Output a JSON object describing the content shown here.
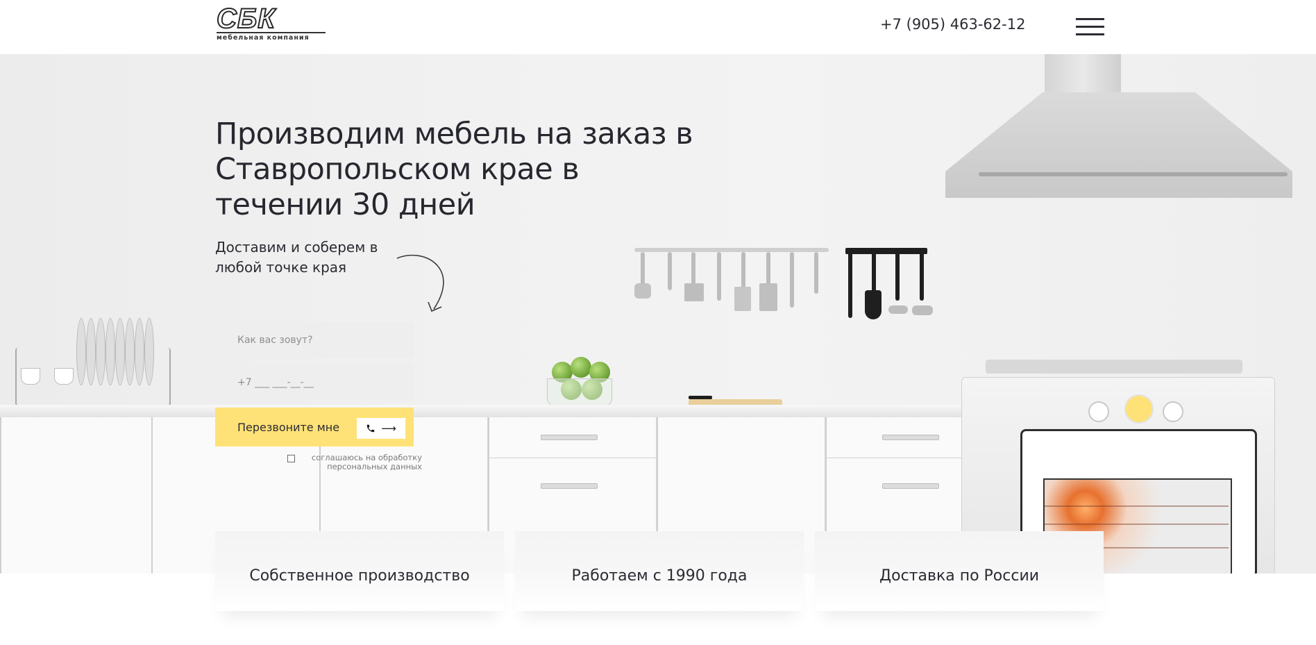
{
  "header": {
    "logo_text": "СБК",
    "logo_subtitle": "мебельная компания",
    "phone": "+7 (905) 463-62-12",
    "menu_icon": "hamburger-menu-icon"
  },
  "hero": {
    "title": "Производим мебель на заказ в Ставропольском крае в течении 30 дней",
    "subtitle": "Доставим и соберем в любой точке края",
    "arrow_icon": "curved-arrow-icon"
  },
  "form": {
    "name_placeholder": "Как вас зовут?",
    "phone_placeholder": "+7 ___ ___-__-__",
    "submit_label": "Перезвоните мне",
    "submit_icons": "phone-icon, arrow-right-icon",
    "consent_text": "соглашаюсь на обработку персональных данных"
  },
  "features": [
    {
      "label": "Собственное производство"
    },
    {
      "label": "Работаем с 1990 года"
    },
    {
      "label": "Доставка по России"
    }
  ],
  "colors": {
    "accent": "#ffe277",
    "text": "#2b2b33",
    "background": "#ffffff"
  }
}
